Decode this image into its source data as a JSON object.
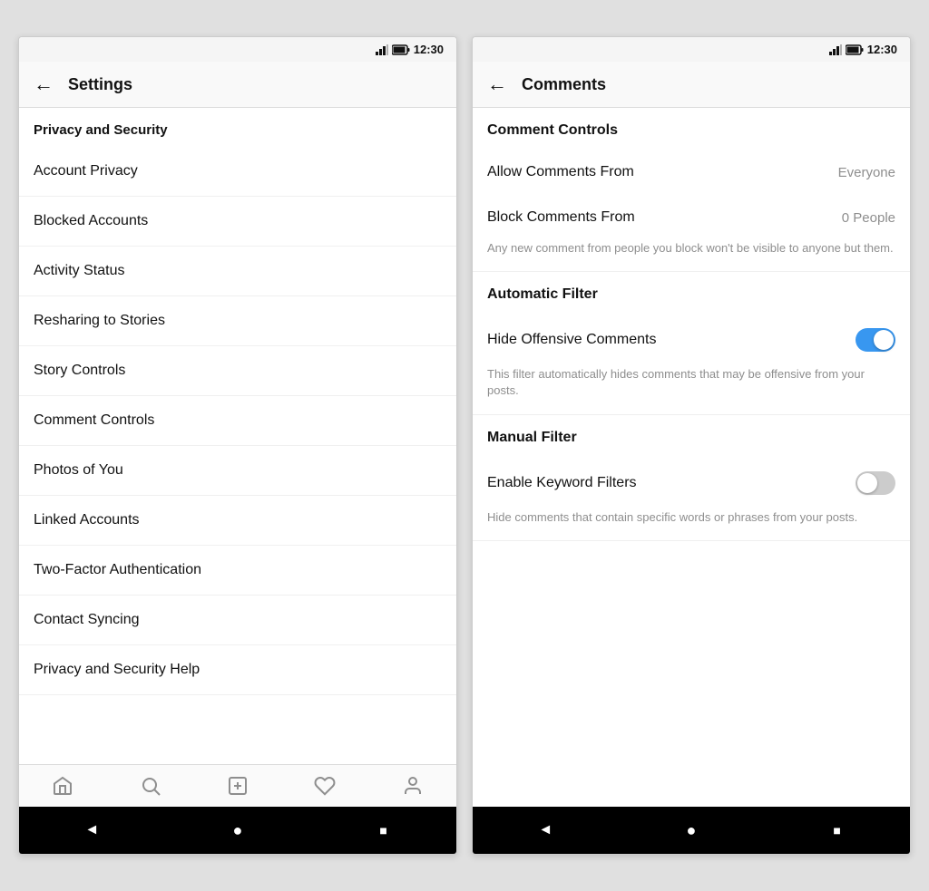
{
  "settings_screen": {
    "status_bar": {
      "time": "12:30"
    },
    "header": {
      "back_label": "←",
      "title": "Settings"
    },
    "section": {
      "title": "Privacy and Security"
    },
    "menu_items": [
      {
        "label": "Account Privacy"
      },
      {
        "label": "Blocked Accounts"
      },
      {
        "label": "Activity Status"
      },
      {
        "label": "Resharing to Stories"
      },
      {
        "label": "Story Controls"
      },
      {
        "label": "Comment Controls"
      },
      {
        "label": "Photos of You"
      },
      {
        "label": "Linked Accounts"
      },
      {
        "label": "Two-Factor Authentication"
      },
      {
        "label": "Contact Syncing"
      },
      {
        "label": "Privacy and Security Help"
      }
    ],
    "nav": {
      "items": [
        "home",
        "search",
        "add",
        "heart",
        "profile"
      ]
    },
    "android": {
      "back": "◄",
      "home": "●",
      "recent": "■"
    }
  },
  "comments_screen": {
    "status_bar": {
      "time": "12:30"
    },
    "header": {
      "back_label": "←",
      "title": "Comments"
    },
    "comment_controls": {
      "section_title": "Comment Controls",
      "allow_label": "Allow Comments From",
      "allow_value": "Everyone",
      "block_label": "Block Comments From",
      "block_value": "0 People",
      "block_desc": "Any new comment from people you block won't be visible to anyone but them."
    },
    "automatic_filter": {
      "section_title": "Automatic Filter",
      "toggle_label": "Hide Offensive Comments",
      "toggle_state": "on",
      "desc": "This filter automatically hides comments that may be offensive from your posts."
    },
    "manual_filter": {
      "section_title": "Manual Filter",
      "toggle_label": "Enable Keyword Filters",
      "toggle_state": "off",
      "desc": "Hide comments that contain specific words or phrases from your posts."
    },
    "android": {
      "back": "◄",
      "home": "●",
      "recent": "■"
    }
  }
}
